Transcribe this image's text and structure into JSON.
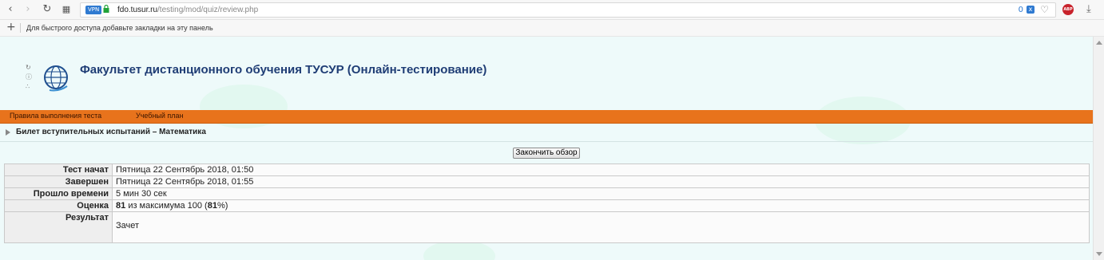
{
  "browser": {
    "vpn_label": "VPN",
    "url_host": "fdo.tusur.ru",
    "url_path": "/testing/mod/quiz/review.php",
    "address_count": "0",
    "abp_label": "ABP",
    "bookmarks_hint": "Для быстрого доступа добавьте закладки на эту панель"
  },
  "site": {
    "title": "Факультет дистанционного обучения ТУСУР (Онлайн-тестирование)"
  },
  "menu": {
    "items": [
      {
        "label": "Правила выполнения теста"
      },
      {
        "label": "Учебный план"
      }
    ]
  },
  "breadcrumb": {
    "text": "Билет вступительных испытаний – Математика"
  },
  "finish_button": "Закончить обзор",
  "summary": {
    "rows": [
      {
        "label": "Тест начат",
        "value": "Пятница 22 Сентябрь 2018, 01:50"
      },
      {
        "label": "Завершен",
        "value": "Пятница 22 Сентябрь 2018, 01:55"
      },
      {
        "label": "Прошло времени",
        "value": "5 мин 30 сек"
      }
    ],
    "grade": {
      "label": "Оценка",
      "score": "81",
      "mid_text": "из максимума 100 (",
      "percent": "81",
      "end_text": "%)"
    },
    "result": {
      "label": "Результат",
      "value": "Зачет"
    }
  },
  "colors": {
    "menu_bar": "#e8731c",
    "title": "#1f3d75",
    "page_bg": "#eefafa"
  }
}
